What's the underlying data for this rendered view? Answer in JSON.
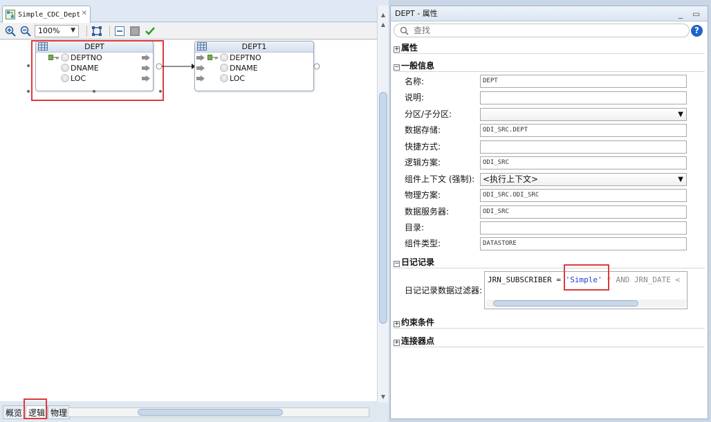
{
  "editor": {
    "tab_title": "Simple_CDC_Dept",
    "zoom": "100%",
    "view_tabs": [
      "概览",
      "逻辑",
      "物理"
    ]
  },
  "diagram": {
    "source": {
      "name": "DEPT",
      "attributes": [
        "DEPTNO",
        "DNAME",
        "LOC"
      ]
    },
    "target": {
      "name": "DEPT1",
      "attributes": [
        "DEPTNO",
        "DNAME",
        "LOC"
      ]
    }
  },
  "properties": {
    "title": "DEPT - 属性",
    "search_placeholder": "查找",
    "help": "?",
    "sections": {
      "attributes": "属性",
      "general": "一般信息",
      "journal": "日记记录",
      "constraints": "约束条件",
      "connector_points": "连接器点"
    },
    "general_fields": [
      {
        "label": "名称:",
        "value": "DEPT"
      },
      {
        "label": "说明:",
        "value": ""
      },
      {
        "label": "分区/子分区:",
        "value": ""
      },
      {
        "label": "数据存储:",
        "value": "ODI_SRC.DEPT"
      },
      {
        "label": "快捷方式:",
        "value": ""
      },
      {
        "label": "逻辑方案:",
        "value": "ODI_SRC"
      },
      {
        "label": "组件上下文 (强制):",
        "value": "<执行上下文>"
      },
      {
        "label": "物理方案:",
        "value": "ODI_SRC.ODI_SRC"
      },
      {
        "label": "数据服务器:",
        "value": "ODI_SRC"
      },
      {
        "label": "目录:",
        "value": ""
      },
      {
        "label": "组件类型:",
        "value": "DATASTORE"
      }
    ],
    "journal": {
      "label": "日记记录数据过滤器:",
      "code_prefix": "JRN_SUBSCRIBER = ",
      "code_string": "'Simple'",
      "code_suffix": " * AND JRN_DATE <"
    }
  },
  "colors": {
    "highlight_red": "#e0383b",
    "code_string_blue": "#1f3bd2",
    "help_blue": "#1f64c8"
  }
}
